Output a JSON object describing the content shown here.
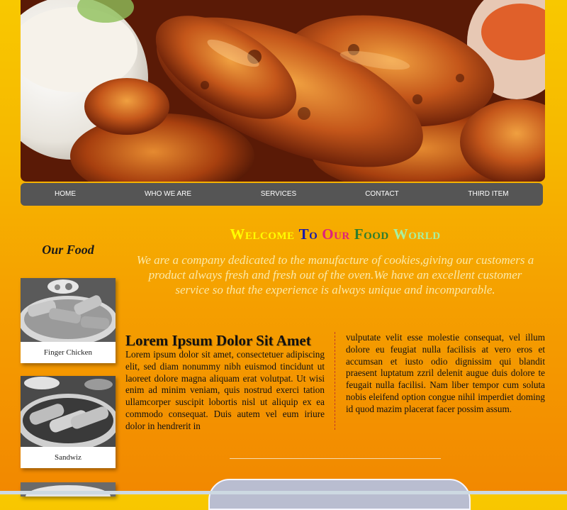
{
  "hero": {
    "image": "chicken-wings-photo"
  },
  "nav": {
    "items": [
      "HOME",
      "WHO WE ARE",
      "SERVICES",
      "CONTACT",
      "THIRD ITEM"
    ]
  },
  "sidebar": {
    "title": "Our Food",
    "cards": [
      {
        "caption": "Finger Chicken",
        "image": "finger-chicken-photo"
      },
      {
        "caption": "Sandwiz",
        "image": "sandwiz-photo"
      }
    ]
  },
  "welcome": {
    "words": [
      {
        "text": "Welcome",
        "color": "#ffff00"
      },
      {
        "text": "To",
        "color": "#1a1aa8"
      },
      {
        "text": "Our",
        "color": "#e0207a"
      },
      {
        "text": "Food",
        "color": "#2e7d2e"
      },
      {
        "text": "World",
        "color": "#a8f0a0"
      }
    ]
  },
  "intro": "We are a company dedicated to the manufacture of cookies,giving our customers a product always fresh and fresh out of the oven.We have an excellent customer service so that the experience is always unique and incomparable.",
  "article": {
    "heading": "Lorem Ipsum Dolor Sit Amet",
    "left_text": "Lorem ipsum dolor sit amet, consectetuer adipiscing elit, sed diam nonummy nibh euismod tincidunt ut laoreet dolore magna aliquam erat volutpat. Ut wisi enim ad minim veniam, quis nostrud exerci tation ullamcorper suscipit lobortis nisl ut aliquip ex ea commodo consequat. Duis autem vel eum iriure dolor in hendrerit in",
    "right_text": "vulputate velit esse molestie consequat, vel illum dolore eu feugiat nulla facilisis at vero eros et accumsan et iusto odio dignissim qui blandit praesent luptatum zzril delenit augue duis dolore te feugait nulla facilisi. Nam liber tempor cum soluta nobis eleifend option congue nihil imperdiet doming id quod mazim placerat facer possim assum."
  },
  "colors": {
    "background_top": "#f8c800",
    "background_bottom": "#f28800",
    "nav": "#555555",
    "intro_text": "#fbe9a8"
  }
}
